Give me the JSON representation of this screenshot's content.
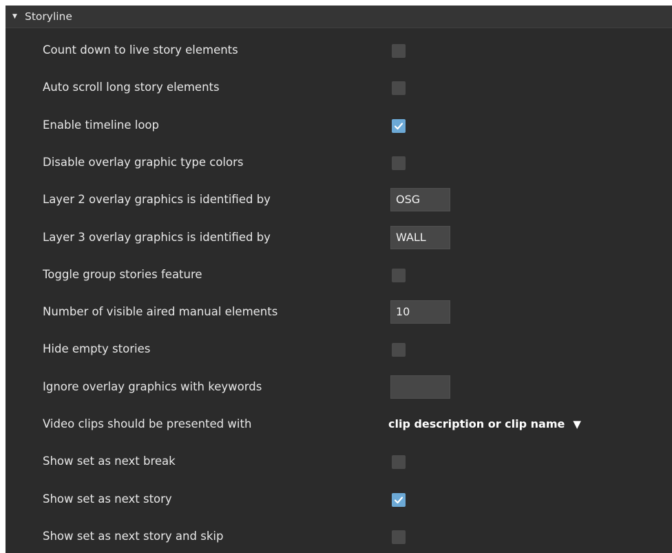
{
  "section": {
    "title": "Storyline",
    "expanded_indicator": "▼"
  },
  "rows": [
    {
      "label": "Count down to live story elements",
      "control": "checkbox",
      "checked": false
    },
    {
      "label": "Auto scroll long story elements",
      "control": "checkbox",
      "checked": false
    },
    {
      "label": "Enable timeline loop",
      "control": "checkbox",
      "checked": true
    },
    {
      "label": "Disable overlay graphic type colors",
      "control": "checkbox",
      "checked": false
    },
    {
      "label": "Layer 2 overlay graphics is identified by",
      "control": "text",
      "value": "OSG"
    },
    {
      "label": "Layer 3 overlay graphics is identified by",
      "control": "text",
      "value": "WALL"
    },
    {
      "label": "Toggle group stories feature",
      "control": "checkbox",
      "checked": false
    },
    {
      "label": "Number of visible aired manual elements",
      "control": "text",
      "value": "10"
    },
    {
      "label": "Hide empty stories",
      "control": "checkbox",
      "checked": false
    },
    {
      "label": "Ignore overlay graphics with keywords",
      "control": "text",
      "value": ""
    },
    {
      "label": "Video clips should be presented with",
      "control": "dropdown",
      "value": "clip description or clip name"
    },
    {
      "label": "Show set as next break",
      "control": "checkbox",
      "checked": false
    },
    {
      "label": "Show set as next story",
      "control": "checkbox",
      "checked": true
    },
    {
      "label": "Show set as next story and skip",
      "control": "checkbox",
      "checked": false
    }
  ],
  "colors": {
    "panel_background": "#2b2b2b",
    "header_background": "#353535",
    "checkbox_unchecked": "#4a4a4a",
    "checkbox_checked": "#6ca9d6",
    "text": "#e8e8e8"
  }
}
